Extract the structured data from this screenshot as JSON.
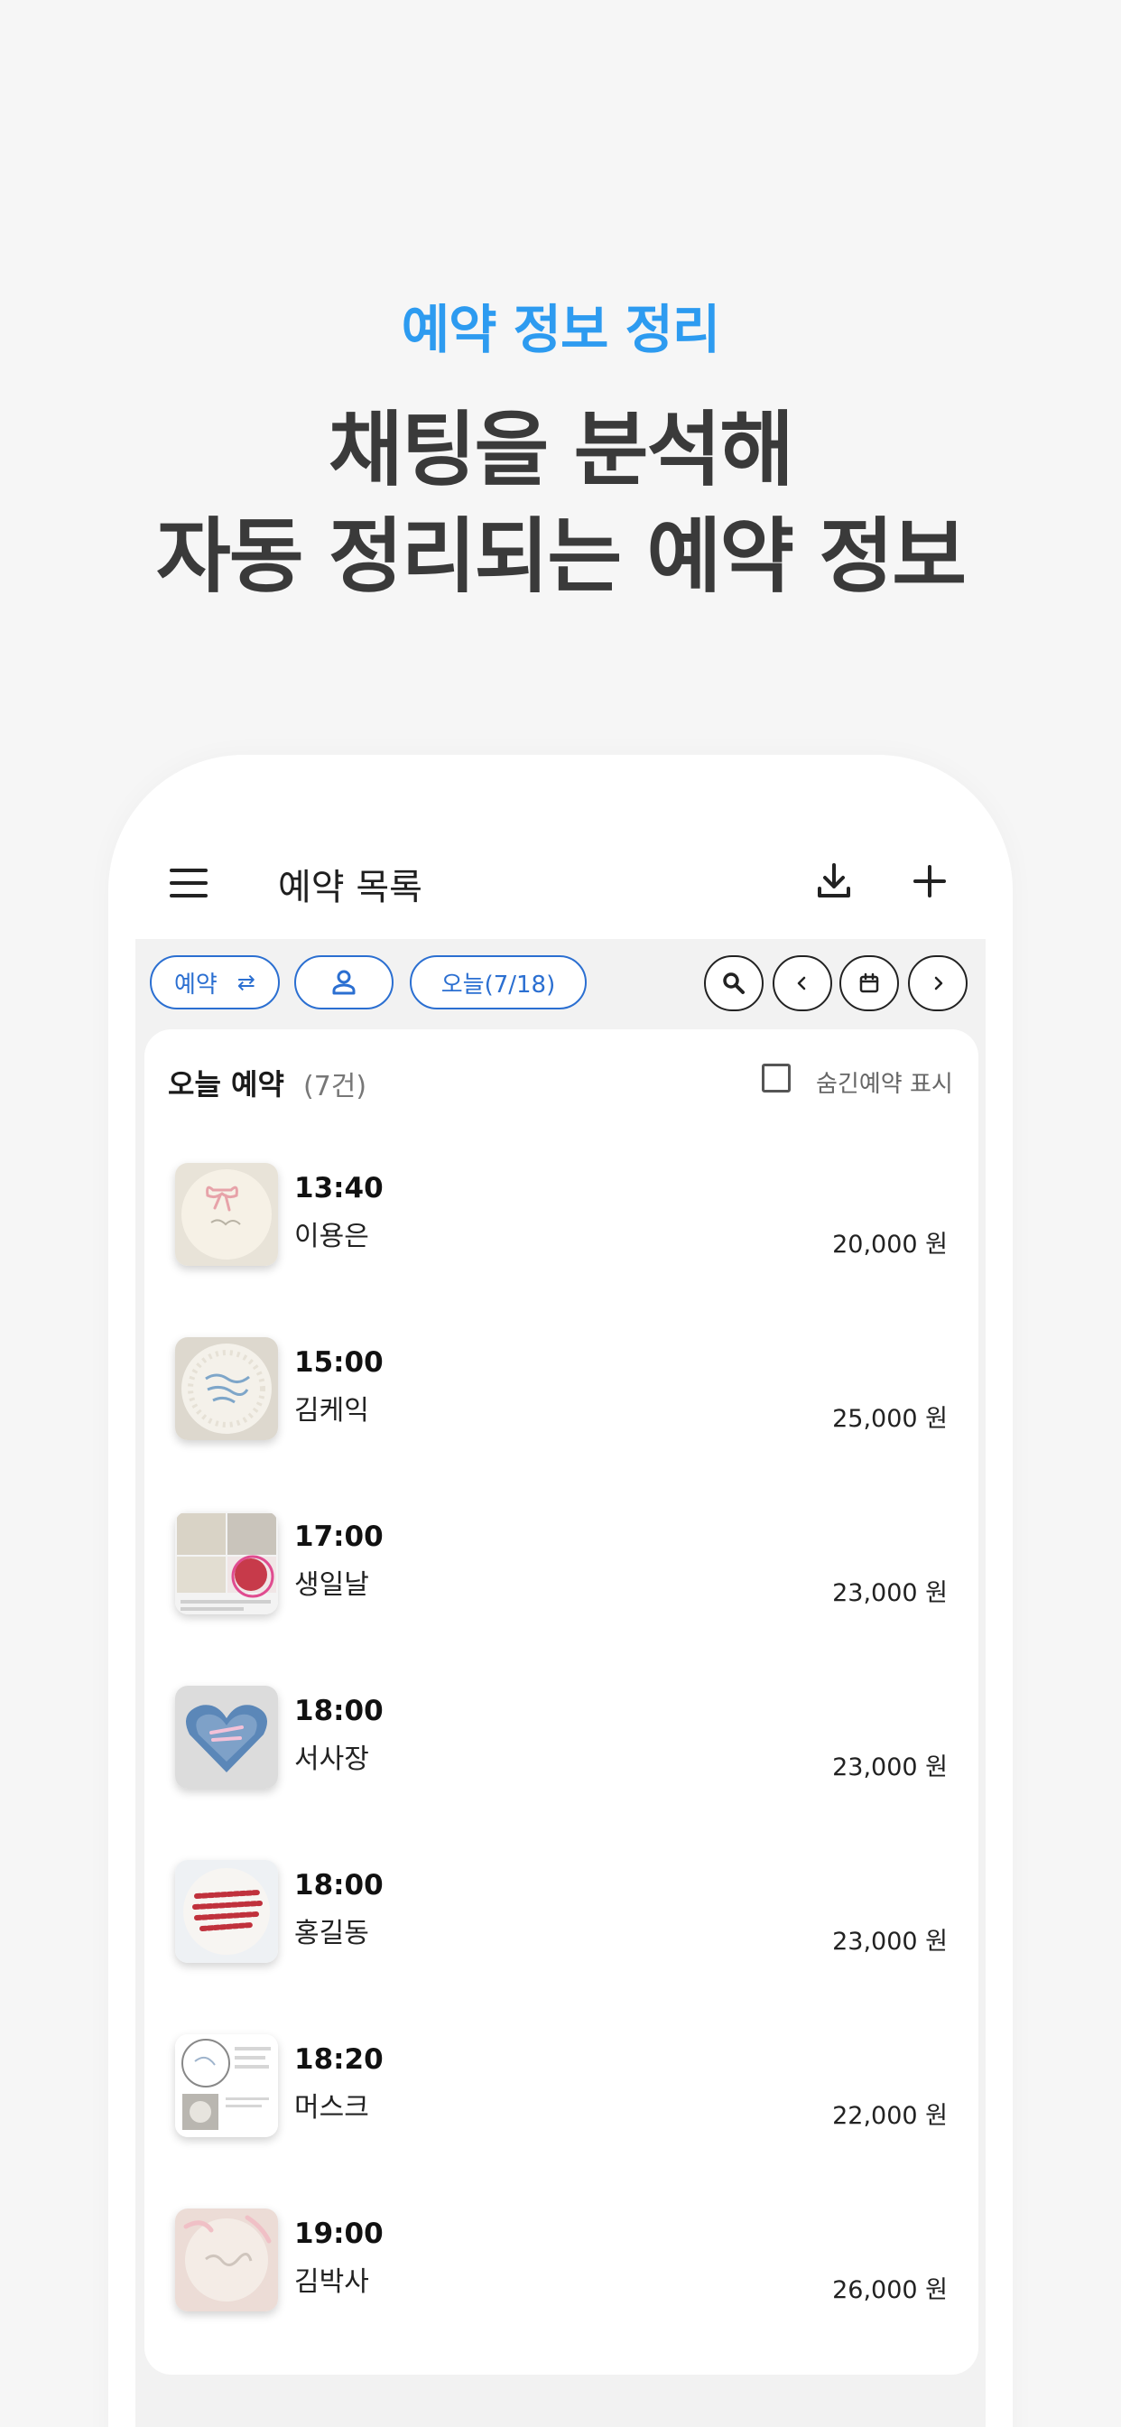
{
  "promo": {
    "subtitle": "예약 정보 정리",
    "title_line1": "채팅을 분석해",
    "title_line2": "자동 정리되는 예약 정보"
  },
  "appbar": {
    "title": "예약 목록",
    "icons": [
      "menu-icon",
      "download-icon",
      "add-icon"
    ]
  },
  "filters": {
    "type_chip": "예약",
    "type_chip_icon": "swap-icon",
    "person_chip_icon": "person-icon",
    "date_chip": "오늘(7/18)",
    "nav_icons": [
      "search-icon",
      "chevron-left-icon",
      "calendar-icon",
      "chevron-right-icon"
    ]
  },
  "list": {
    "title": "오늘 예약",
    "count": "(7건)",
    "hidden_toggle_label": "숨긴예약 표시",
    "hidden_toggle_checked": false
  },
  "reservations": [
    {
      "time": "13:40",
      "name": "이용은",
      "price": "20,000 원"
    },
    {
      "time": "15:00",
      "name": "김케익",
      "price": "25,000 원"
    },
    {
      "time": "17:00",
      "name": "생일날",
      "price": "23,000 원"
    },
    {
      "time": "18:00",
      "name": "서사장",
      "price": "23,000 원"
    },
    {
      "time": "18:00",
      "name": "홍길동",
      "price": "23,000 원"
    },
    {
      "time": "18:20",
      "name": "머스크",
      "price": "22,000 원"
    },
    {
      "time": "19:00",
      "name": "김박사",
      "price": "26,000 원"
    }
  ],
  "colors": {
    "accent": "#2d9bf0",
    "chip_blue": "#2b6fd1",
    "heading": "#3a3a3a",
    "background": "#f6f6f6"
  }
}
